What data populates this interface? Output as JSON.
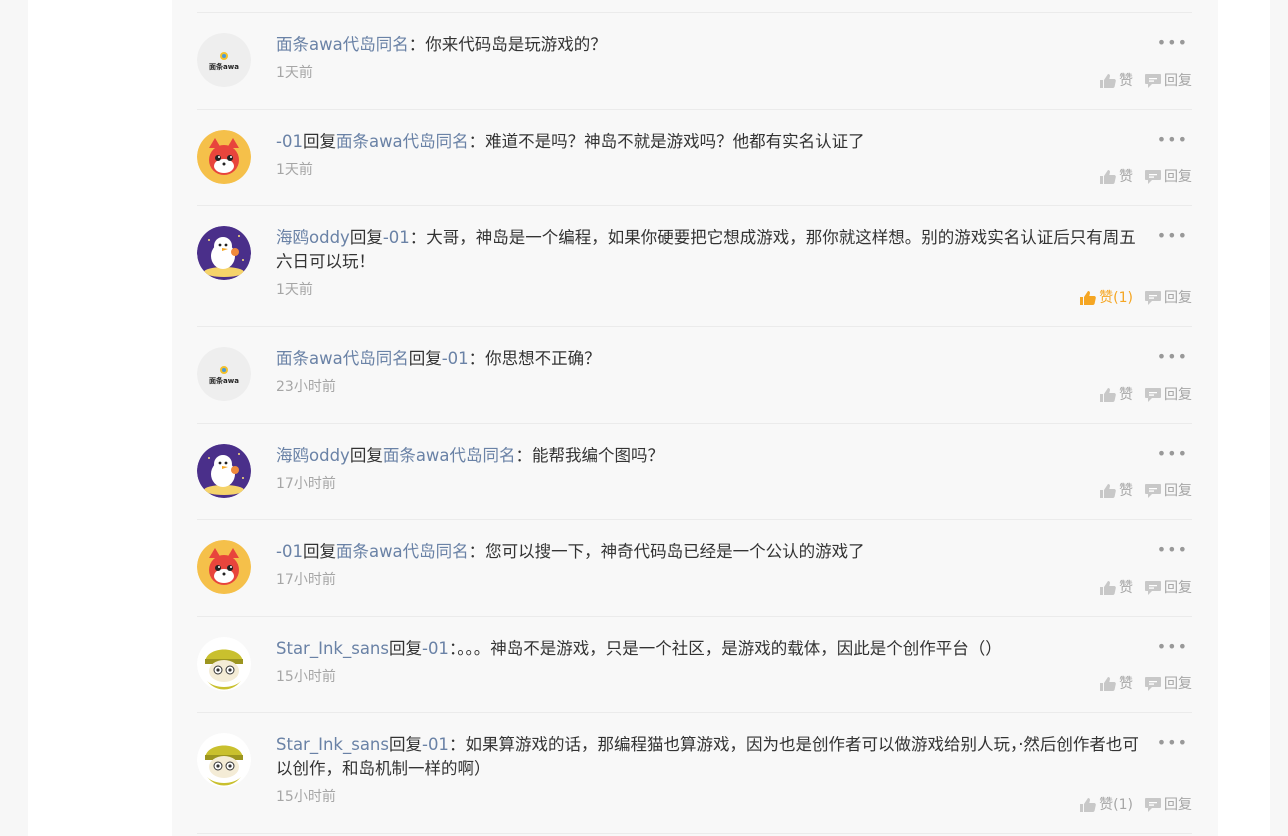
{
  "comments": [
    {
      "avatar": "mianshao",
      "user": "面条awa代岛同名",
      "reply_word": "",
      "target": "",
      "separator": "：",
      "text": "你来代码岛是玩游戏的？",
      "time": "1天前",
      "like_label": "赞",
      "reply_label": "回复",
      "liked": false
    },
    {
      "avatar": "fox",
      "user": "-01",
      "reply_word": "回复",
      "target": "面条awa代岛同名",
      "separator": "：",
      "text": "难道不是吗？神岛不就是游戏吗？他都有实名认证了",
      "time": "1天前",
      "like_label": "赞",
      "reply_label": "回复",
      "liked": false
    },
    {
      "avatar": "seagull",
      "user": "海鸥oddy",
      "reply_word": "回复",
      "target": "-01",
      "separator": "：",
      "text": "大哥，神岛是一个编程，如果你硬要把它想成游戏，那你就这样想。别的游戏实名认证后只有周五六日可以玩！",
      "time": "1天前",
      "like_label": "赞(1)",
      "reply_label": "回复",
      "liked": true
    },
    {
      "avatar": "mianshao",
      "user": "面条awa代岛同名",
      "reply_word": "回复",
      "target": "-01",
      "separator": "：",
      "text": "你思想不正确？",
      "time": "23小时前",
      "like_label": "赞",
      "reply_label": "回复",
      "liked": false
    },
    {
      "avatar": "seagull",
      "user": "海鸥oddy",
      "reply_word": "回复",
      "target": "面条awa代岛同名",
      "separator": "：",
      "text": "能帮我编个图吗？",
      "time": "17小时前",
      "like_label": "赞",
      "reply_label": "回复",
      "liked": false
    },
    {
      "avatar": "fox",
      "user": "-01",
      "reply_word": "回复",
      "target": "面条awa代岛同名",
      "separator": "：",
      "text": "您可以搜一下，神奇代码岛已经是一个公认的游戏了",
      "time": "17小时前",
      "like_label": "赞",
      "reply_label": "回复",
      "liked": false
    },
    {
      "avatar": "sans",
      "user": "Star_Ink_sans",
      "reply_word": "回复",
      "target": "-01",
      "separator": "：",
      "text": "。。。神岛不是游戏，只是一个社区，是游戏的载体，因此是个创作平台（）",
      "time": "15小时前",
      "like_label": "赞",
      "reply_label": "回复",
      "liked": false
    },
    {
      "avatar": "sans",
      "user": "Star_Ink_sans",
      "reply_word": "回复",
      "target": "-01",
      "separator": "：",
      "text": "如果算游戏的话，那编程猫也算游戏，因为也是创作者可以做游戏给别人玩，·然后创作者也可以创作，和岛机制一样的啊）",
      "time": "15小时前",
      "like_label": "赞(1)",
      "reply_label": "回复",
      "liked": false
    }
  ],
  "avatar_texts": {
    "mianshao": "面条awa"
  },
  "more_icon": "more-dots-icon",
  "colors": {
    "username": "#6a82a6",
    "text": "#333333",
    "meta": "#a6a6a6",
    "liked": "#f5a623"
  }
}
